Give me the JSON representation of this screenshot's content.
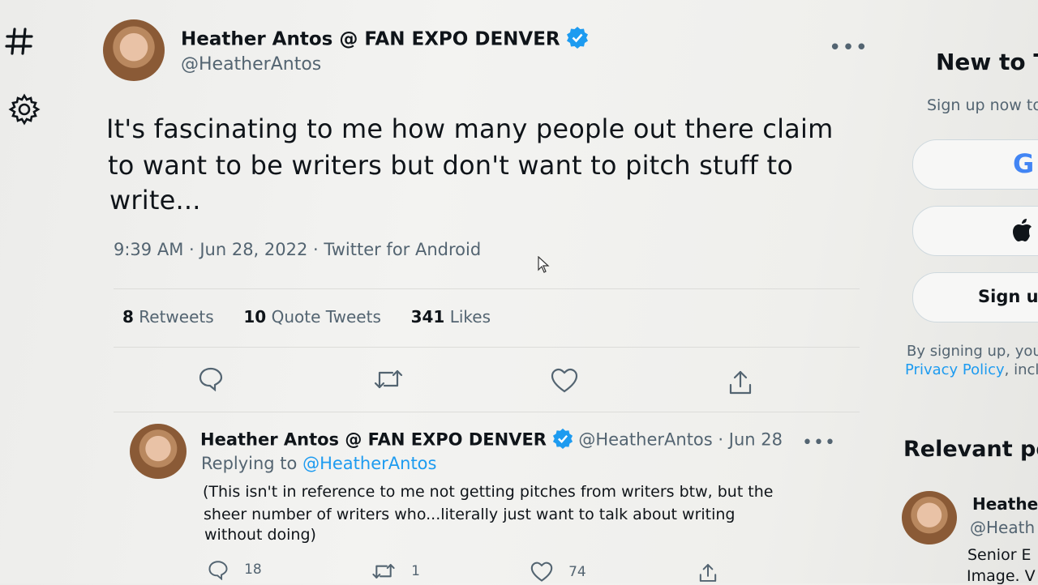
{
  "sidebar": {
    "items": [
      {
        "icon": "hashtag-icon",
        "label": "Explore"
      },
      {
        "icon": "gear-icon",
        "label": "Settings"
      }
    ]
  },
  "tweet": {
    "author_name": "Heather Antos @ FAN EXPO DENVER",
    "handle": "@HeatherAntos",
    "text_lines": [
      "It's fascinating to me how many people out there claim",
      "to want to be writers but don't want to pitch stuff to",
      "write..."
    ],
    "timestamp": "9:39 AM · Jun 28, 2022 · Twitter for Android",
    "stats": {
      "retweets_count": "8",
      "retweets_label": "Retweets",
      "quotes_count": "10",
      "quotes_label": "Quote Tweets",
      "likes_count": "341",
      "likes_label": "Likes"
    }
  },
  "reply": {
    "author_name": "Heather Antos @ FAN EXPO DENVER",
    "handle_date": "@HeatherAntos · Jun 28",
    "replying_prefix": "Replying to",
    "replying_handle": "@HeatherAntos",
    "text_lines": [
      "(This isn't in reference to me not getting pitches from writers btw, but the",
      "sheer number of writers who...literally just want to talk about writing",
      "without doing)"
    ],
    "reply_count": "18",
    "retweet_count": "1",
    "like_count": "74"
  },
  "right_panel": {
    "new_title": "New to T",
    "signup_subtitle": "Sign up now to",
    "google_glyph": "G",
    "signup_label": "Sign up",
    "terms_line1": "By signing up, you",
    "terms_link": "Privacy Policy",
    "terms_line2_suffix": ", incl",
    "relevant_title": "Relevant pe",
    "person_name": "Heathe",
    "person_handle": "@Heath",
    "person_bio_line1": "Senior E",
    "person_bio_line2": "Image. V"
  },
  "colors": {
    "accent": "#1d9bf0",
    "text": "#0f1419",
    "muted": "#536471"
  }
}
